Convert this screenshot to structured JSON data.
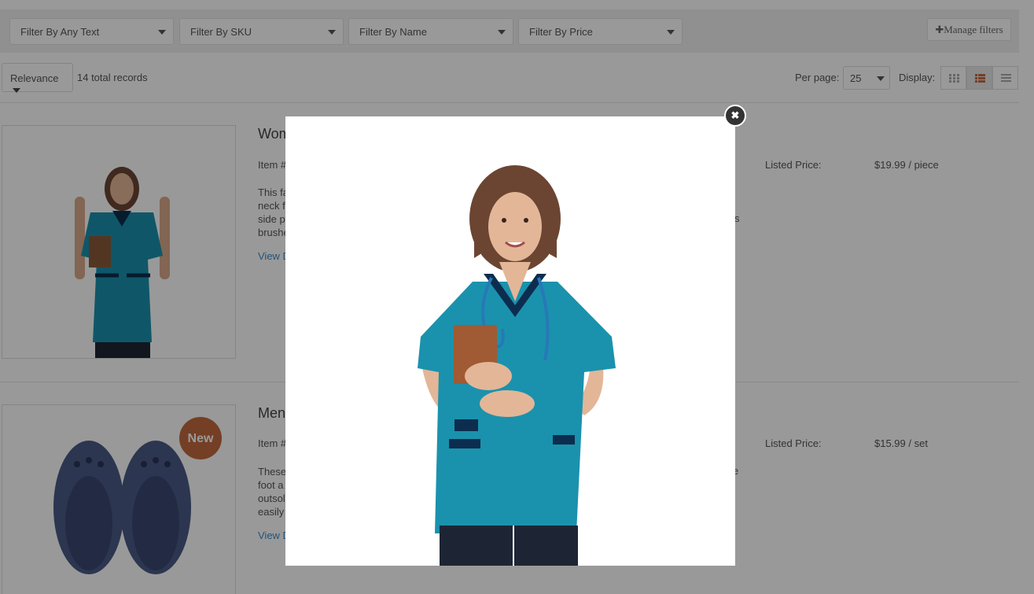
{
  "filters": {
    "any_text": "Filter By Any Text",
    "sku": "Filter By SKU",
    "name": "Filter By Name",
    "price": "Filter By Price",
    "manage": "✚Manage filters"
  },
  "sort": {
    "selected": "Relevance",
    "total": "14 total records",
    "per_page_label": "Per page:",
    "per_page_value": "25",
    "display_label": "Display:"
  },
  "products": [
    {
      "title": "Wom",
      "item": "Item #",
      "desc_lines": [
        "This fa",
        "neck f",
        "side p",
        "brushe"
      ],
      "desc_tail": "s",
      "link": "View D",
      "price_label": "Listed Price:",
      "price": "$19.99 / piece"
    },
    {
      "title": "Men",
      "item": "Item #",
      "desc_lines": [
        "These",
        "foot a",
        "outsol",
        "easily"
      ],
      "desc_tail": "e",
      "link": "View D",
      "price_label": "Listed Price:",
      "price": "$15.99 / set",
      "badge": "New"
    }
  ],
  "modal": {
    "close_icon": "close-icon",
    "close_glyph": "✖"
  },
  "colors": {
    "accent": "#c26a3e",
    "scrub": "#1a92ad",
    "link": "#3a8dc9"
  }
}
